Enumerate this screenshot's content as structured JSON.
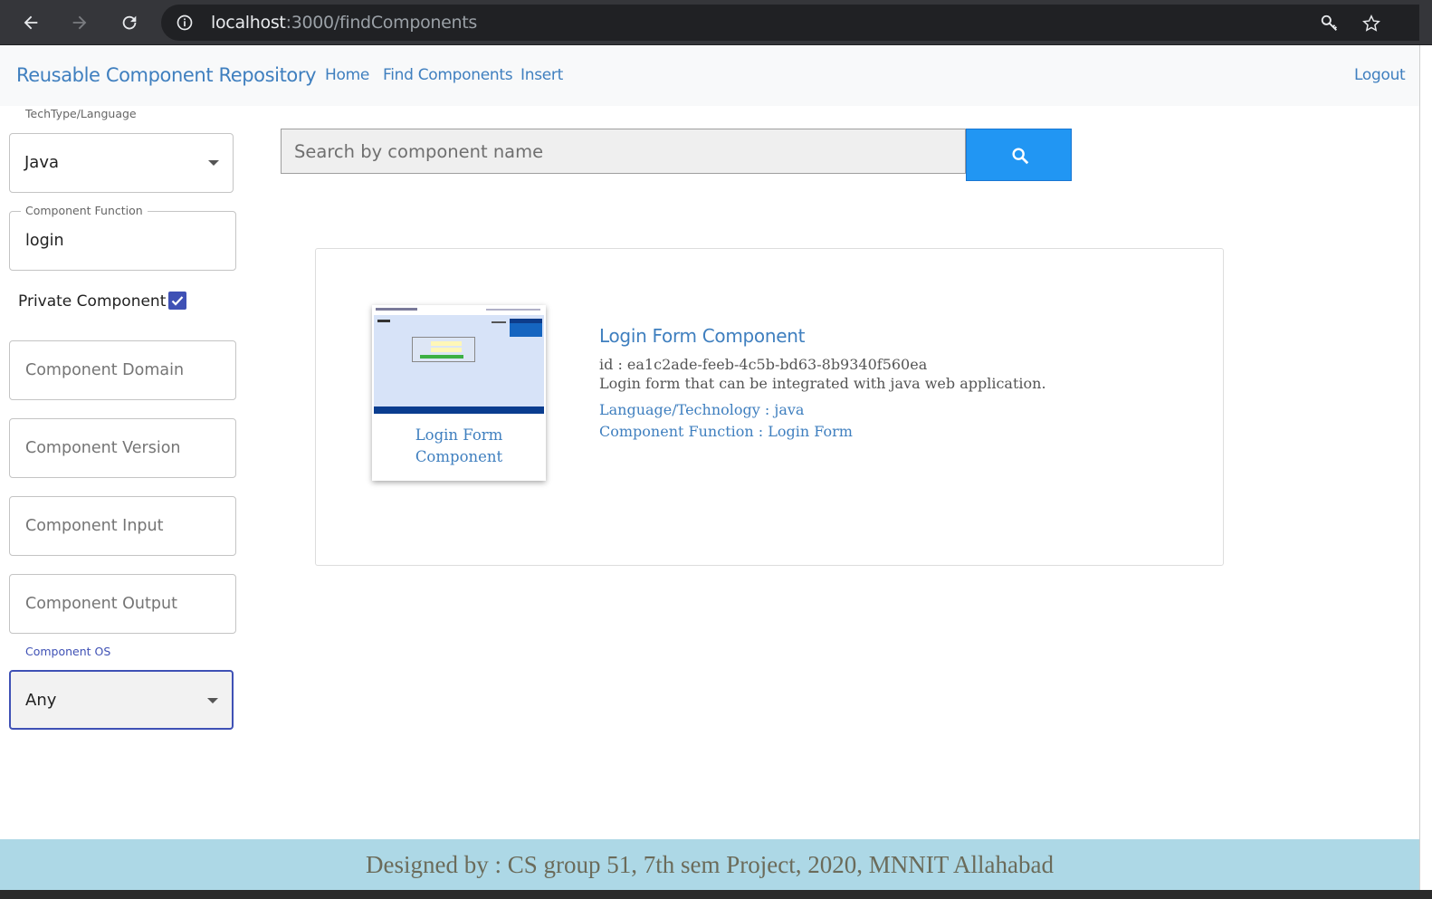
{
  "browser": {
    "url_host": "localhost",
    "url_path": ":3000/findComponents"
  },
  "navbar": {
    "brand": "Reusable Component Repository",
    "links": [
      "Home",
      "Find Components",
      "Insert"
    ],
    "logout": "Logout"
  },
  "filters": {
    "techtype_label": "TechType/Language",
    "techtype_value": "Java",
    "function_label": "Component Function",
    "function_value": "login",
    "private_label": "Private Component",
    "private_checked": true,
    "domain_placeholder": "Component Domain",
    "version_placeholder": "Component Version",
    "input_placeholder": "Component Input",
    "output_placeholder": "Component Output",
    "os_label": "Component OS",
    "os_value": "Any"
  },
  "search": {
    "placeholder": "Search by component name"
  },
  "result": {
    "thumb_title": "Login Form Component",
    "name": "Login Form Component",
    "id": "id : ea1c2ade-feeb-4c5b-bd63-8b9340f560ea",
    "description": "Login form that can be integrated with java web application.",
    "language": "Language/Technology : java",
    "function": "Component Function : Login Form"
  },
  "footer": {
    "text": "Designed by : CS group 51, 7th sem Project, 2020, MNNIT Allahabad"
  },
  "colors": {
    "accent": "#3f7fbf",
    "search_button": "#2196f3",
    "checkbox": "#3f51b5",
    "footer_bg": "#add8e6"
  }
}
